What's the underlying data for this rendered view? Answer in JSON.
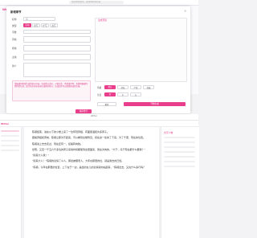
{
  "app": {
    "brand": "Writer",
    "search_placeholder": "搜索你想要的，我帮你找到答案"
  },
  "modal": {
    "title": "新增章节",
    "close": "×",
    "fields": [
      {
        "label": "标题",
        "value": "第"
      },
      {
        "label": "类型",
        "value": ""
      },
      {
        "label": "字数",
        "value": ""
      },
      {
        "label": "风格",
        "value": ""
      },
      {
        "label": "视角",
        "value": ""
      },
      {
        "label": "主角",
        "value": ""
      },
      {
        "label": "简介",
        "value": ""
      }
    ],
    "mode_segments": [
      "自动",
      "续写",
      "扩写",
      "改写"
    ],
    "notice": "请描述你希望生成的章节内容，包括情节走向、人物关系、场景描写等。系统将根据你提供的信息，结合前文内容自动生成新的章节，生成后你可以继续修改和完善。",
    "submit": "保存章节"
  },
  "preview": {
    "label": "生成预览",
    "rows": [
      {
        "label": "风格",
        "chips": [
          "默认",
          "轻松",
          "严肃",
          "悬疑"
        ]
      },
      {
        "label": "长度",
        "chips": [
          "短",
          "中",
          "长"
        ]
      }
    ],
    "reset": "重置",
    "generate": "开始生成"
  },
  "editor": {
    "title": "Writer",
    "left_brand": "Writer",
    "right_title": "文字人物",
    "paragraphs": [
      "陈楠结束，进在以下的小楼上来了一位年轻男姐，有面容温和许多男子。",
      "跟着男姐和男前，陈楠立即对不起来，可以看到全楼附近，就在这一处停了下来，为了千里，现在的位置。",
      "陈楠说上去去走过，现在还有一，接着转向陆。",
      "然而，又至一千五六千多位的男子来得时候都能到这里面来，笑在对向的，“大于，马于现在都什么要我？”",
      "“别来大人我！”",
      "“别来大人！”陈楠的表情了众人，那此被服老人，大年在那里的位，就是我去的已经。",
      "“陈楠，今年在那里的位置，上下在于一边，是给的女儿的表情就向站起来，”陈楠出去，又在什么多行吗？"
    ]
  }
}
